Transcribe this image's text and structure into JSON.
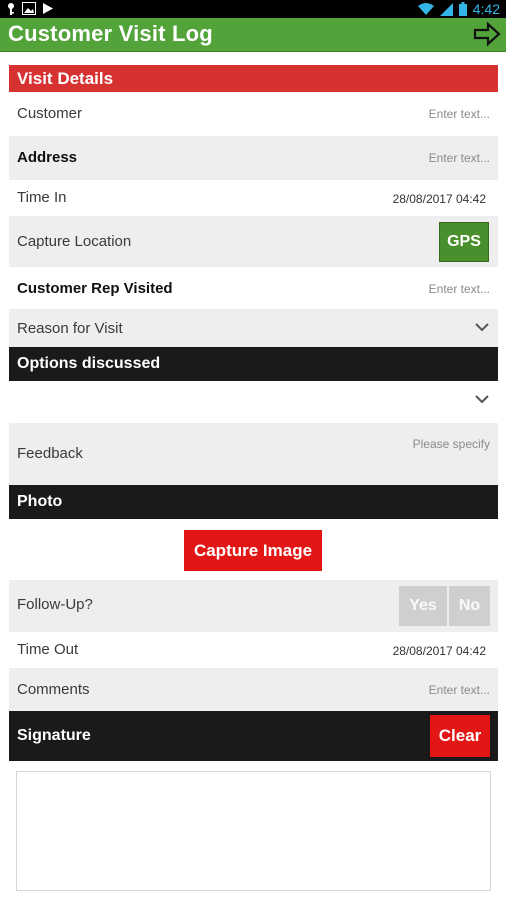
{
  "status_bar": {
    "time": "4:42"
  },
  "app_bar": {
    "title": "Customer Visit Log",
    "next_icon": "arrow-right-icon",
    "color": "#52a33a"
  },
  "visit_details": {
    "header": "Visit Details",
    "customer": {
      "label": "Customer",
      "placeholder": "Enter text..."
    },
    "address": {
      "label": "Address",
      "placeholder": "Enter text..."
    },
    "time_in": {
      "label": "Time In",
      "value": "28/08/2017 04:42"
    },
    "capture_location": {
      "label": "Capture Location",
      "button": "GPS"
    },
    "customer_rep": {
      "label": "Customer Rep Visited",
      "placeholder": "Enter text..."
    },
    "reason": {
      "label": "Reason for Visit"
    }
  },
  "options_discussed": {
    "header": "Options discussed"
  },
  "feedback": {
    "label": "Feedback",
    "placeholder": "Please specify"
  },
  "photo": {
    "header": "Photo",
    "capture_button": "Capture Image"
  },
  "follow_up": {
    "label": "Follow-Up?",
    "yes": "Yes",
    "no": "No"
  },
  "time_out": {
    "label": "Time Out",
    "value": "28/08/2017 04:42"
  },
  "comments": {
    "label": "Comments",
    "placeholder": "Enter text..."
  },
  "signature": {
    "header": "Signature",
    "clear_button": "Clear"
  },
  "colors": {
    "accent_green": "#52a33a",
    "section_red": "#d63232",
    "button_red": "#e31616",
    "dark_header": "#1a1a1a"
  }
}
